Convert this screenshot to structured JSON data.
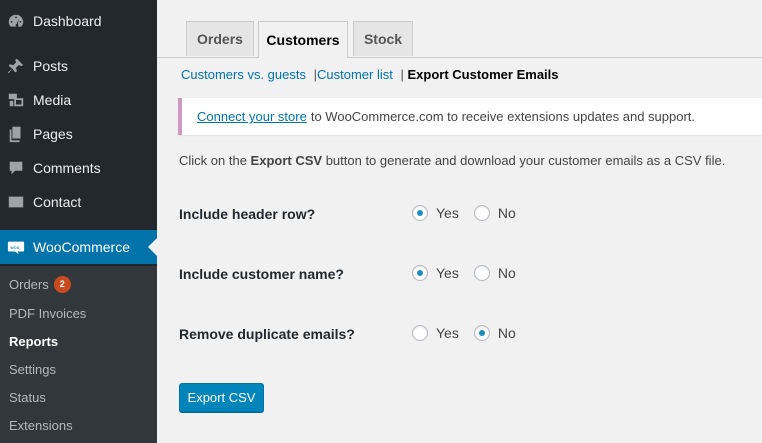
{
  "sidebar": {
    "items": [
      {
        "label": "Dashboard",
        "icon": "dashboard-icon"
      },
      {
        "label": "Posts",
        "icon": "pin-icon"
      },
      {
        "label": "Media",
        "icon": "media-icon"
      },
      {
        "label": "Pages",
        "icon": "pages-icon"
      },
      {
        "label": "Comments",
        "icon": "comment-icon"
      },
      {
        "label": "Contact",
        "icon": "mail-icon"
      },
      {
        "label": "WooCommerce",
        "icon": "woo-icon"
      }
    ],
    "submenu": [
      {
        "label": "Orders",
        "badge": "2"
      },
      {
        "label": "PDF Invoices"
      },
      {
        "label": "Reports"
      },
      {
        "label": "Settings"
      },
      {
        "label": "Status"
      },
      {
        "label": "Extensions"
      }
    ]
  },
  "tabs": [
    "Orders",
    "Customers",
    "Stock"
  ],
  "subnav": {
    "link1": "Customers vs. guests",
    "sep1": "|",
    "link2": "Customer list",
    "sep2": "|",
    "current": "Export Customer Emails"
  },
  "notice": {
    "link": "Connect your store",
    "text": "to WooCommerce.com to receive extensions updates and support."
  },
  "description": {
    "before": "Click on the",
    "bold": "Export CSV",
    "after": "button to generate and download your customer emails as a CSV file."
  },
  "options": [
    {
      "label": "Include header row?",
      "yes": "Yes",
      "no": "No",
      "selected": "Yes"
    },
    {
      "label": "Include customer name?",
      "yes": "Yes",
      "no": "No",
      "selected": "Yes"
    },
    {
      "label": "Remove duplicate emails?",
      "yes": "Yes",
      "no": "No",
      "selected": "No"
    }
  ],
  "export_button": "Export CSV",
  "colors": {
    "accent": "#0073aa",
    "sidebar": "#23282d",
    "badge": "#ca4a1f",
    "notice_border": "#cc99c2"
  }
}
